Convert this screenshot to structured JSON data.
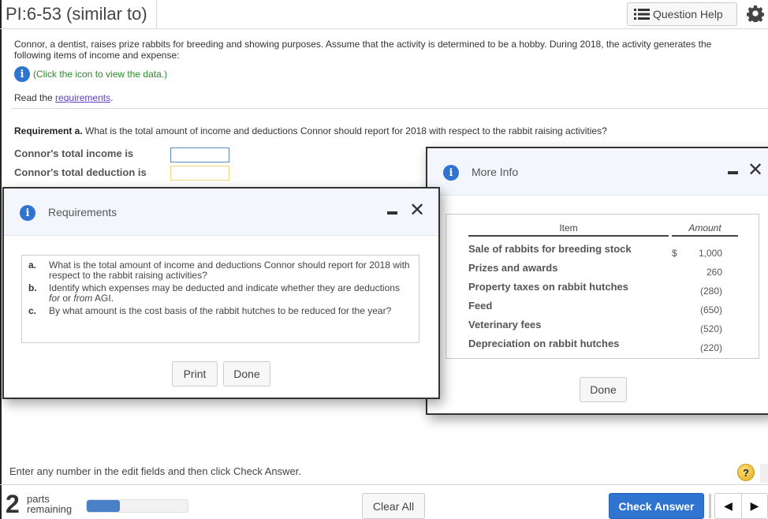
{
  "header": {
    "title": "PI:6-53 (similar to)",
    "question_help_label": "Question Help"
  },
  "problem": {
    "text": "Connor, a dentist, raises prize rabbits for breeding and showing purposes. Assume that the activity is determined to be a hobby. During 2018, the activity generates the following items of income and expense:",
    "data_link": "(Click the icon to view the data.)",
    "read_prefix": "Read the ",
    "read_link": "requirements",
    "read_suffix": "."
  },
  "requirement_a": {
    "label": "Requirement a.",
    "question": " What is the total amount of income and deductions Connor should report for 2018 with respect to the rabbit raising activities?",
    "fields": [
      {
        "label": "Connor's total income is",
        "value": ""
      },
      {
        "label": "Connor's total deduction is",
        "value": ""
      }
    ]
  },
  "more_info_dialog": {
    "title": "More Info",
    "columns": {
      "item": "Item",
      "amount": "Amount"
    },
    "rows": [
      {
        "item": "Sale of rabbits for breeding stock",
        "currency": "$",
        "amount": "1,000"
      },
      {
        "item": "Prizes and awards",
        "currency": "",
        "amount": "260"
      },
      {
        "item": "Property taxes on rabbit hutches",
        "currency": "",
        "amount": "(280)"
      },
      {
        "item": "Feed",
        "currency": "",
        "amount": "(650)"
      },
      {
        "item": "Veterinary fees",
        "currency": "",
        "amount": "(520)"
      },
      {
        "item": "Depreciation on rabbit hutches",
        "currency": "",
        "amount": "(220)"
      }
    ],
    "done_label": "Done"
  },
  "requirements_dialog": {
    "title": "Requirements",
    "items": [
      {
        "letter": "a.",
        "text": "What is the total amount of income and deductions Connor should report for 2018 with respect to the rabbit raising activities?"
      },
      {
        "letter": "b.",
        "text_before": "Identify which expenses may be deducted and indicate whether they are deductions ",
        "em1": "for",
        "mid": " or ",
        "em2": "from",
        "text_after": " AGI."
      },
      {
        "letter": "c.",
        "text": "By what amount is the cost basis of the rabbit hutches to be reduced for the year?"
      }
    ],
    "print_label": "Print",
    "done_label": "Done"
  },
  "footer": {
    "hint": "Enter any number in the edit fields and then click Check Answer.",
    "help_symbol": "?",
    "parts_count": "2",
    "parts_label_1": "parts",
    "parts_label_2": "remaining",
    "progress_fraction": 0.33,
    "clear_all_label": "Clear All",
    "check_answer_label": "Check Answer",
    "prev_symbol": "◀",
    "next_symbol": "▶"
  },
  "colors": {
    "accent": "#2f74d0",
    "link_green": "#2a8a2a",
    "link_purple": "#5b3fc9"
  }
}
